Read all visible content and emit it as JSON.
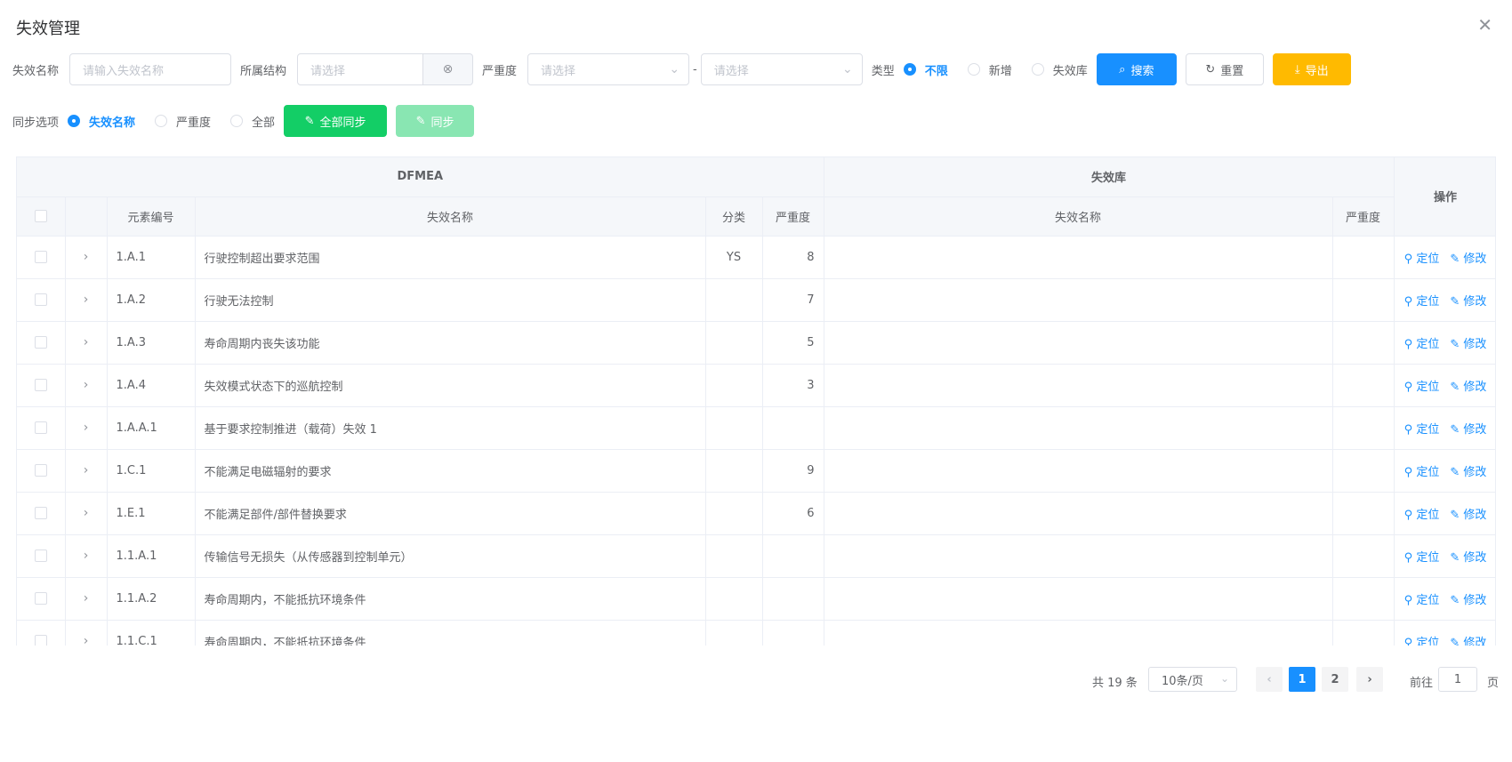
{
  "dialog": {
    "title": "失效管理",
    "close": "✕"
  },
  "filters": {
    "name_label": "失效名称",
    "name_placeholder": "请输入失效名称",
    "struct_label": "所属结构",
    "struct_placeholder": "请选择",
    "severity_label": "严重度",
    "severity_from_placeholder": "请选择",
    "severity_sep": "-",
    "severity_to_placeholder": "请选择",
    "type_label": "类型",
    "type_options": [
      {
        "label": "不限",
        "checked": true
      },
      {
        "label": "新增",
        "checked": false
      },
      {
        "label": "失效库",
        "checked": false
      }
    ],
    "search_label": "搜索",
    "reset_label": "重置",
    "export_label": "导出"
  },
  "sync": {
    "label": "同步选项",
    "options": [
      {
        "label": "失效名称",
        "checked": true
      },
      {
        "label": "严重度",
        "checked": false
      },
      {
        "label": "全部",
        "checked": false
      }
    ],
    "sync_all_label": "全部同步",
    "sync_label": "同步"
  },
  "table": {
    "group_dfmea": "DFMEA",
    "group_lib": "失效库",
    "col_code": "元素编号",
    "col_name": "失效名称",
    "col_category": "分类",
    "col_severity": "严重度",
    "col_lib_name": "失效名称",
    "col_lib_severity": "严重度",
    "col_ops": "操作",
    "op_locate": "定位",
    "op_edit": "修改",
    "rows": [
      {
        "code": "1.A.1",
        "name": "行驶控制超出要求范围",
        "category": "YS",
        "severity": "8",
        "lib_name": "",
        "lib_severity": ""
      },
      {
        "code": "1.A.2",
        "name": "行驶无法控制",
        "category": "",
        "severity": "7",
        "lib_name": "",
        "lib_severity": ""
      },
      {
        "code": "1.A.3",
        "name": "寿命周期内丧失该功能",
        "category": "",
        "severity": "5",
        "lib_name": "",
        "lib_severity": ""
      },
      {
        "code": "1.A.4",
        "name": "失效模式状态下的巡航控制",
        "category": "",
        "severity": "3",
        "lib_name": "",
        "lib_severity": ""
      },
      {
        "code": "1.A.A.1",
        "name": "基于要求控制推进（载荷）失效 1",
        "category": "",
        "severity": "",
        "lib_name": "",
        "lib_severity": ""
      },
      {
        "code": "1.C.1",
        "name": "不能满足电磁辐射的要求",
        "category": "",
        "severity": "9",
        "lib_name": "",
        "lib_severity": ""
      },
      {
        "code": "1.E.1",
        "name": "不能满足部件/部件替换要求",
        "category": "",
        "severity": "6",
        "lib_name": "",
        "lib_severity": ""
      },
      {
        "code": "1.1.A.1",
        "name": "传输信号无损失（从传感器到控制单元）",
        "category": "",
        "severity": "",
        "lib_name": "",
        "lib_severity": ""
      },
      {
        "code": "1.1.A.2",
        "name": "寿命周期内，不能抵抗环境条件",
        "category": "",
        "severity": "",
        "lib_name": "",
        "lib_severity": ""
      },
      {
        "code": "1.1.C.1",
        "name": "寿命周期内，不能抵抗环境条件",
        "category": "",
        "severity": "",
        "lib_name": "",
        "lib_severity": ""
      }
    ]
  },
  "pagination": {
    "total": "共 19 条",
    "page_size": "10条/页",
    "prev": "‹",
    "pages": [
      "1",
      "2"
    ],
    "current": "1",
    "next": "›",
    "goto_label": "前往",
    "goto_value": "1",
    "page_suffix": "页"
  }
}
